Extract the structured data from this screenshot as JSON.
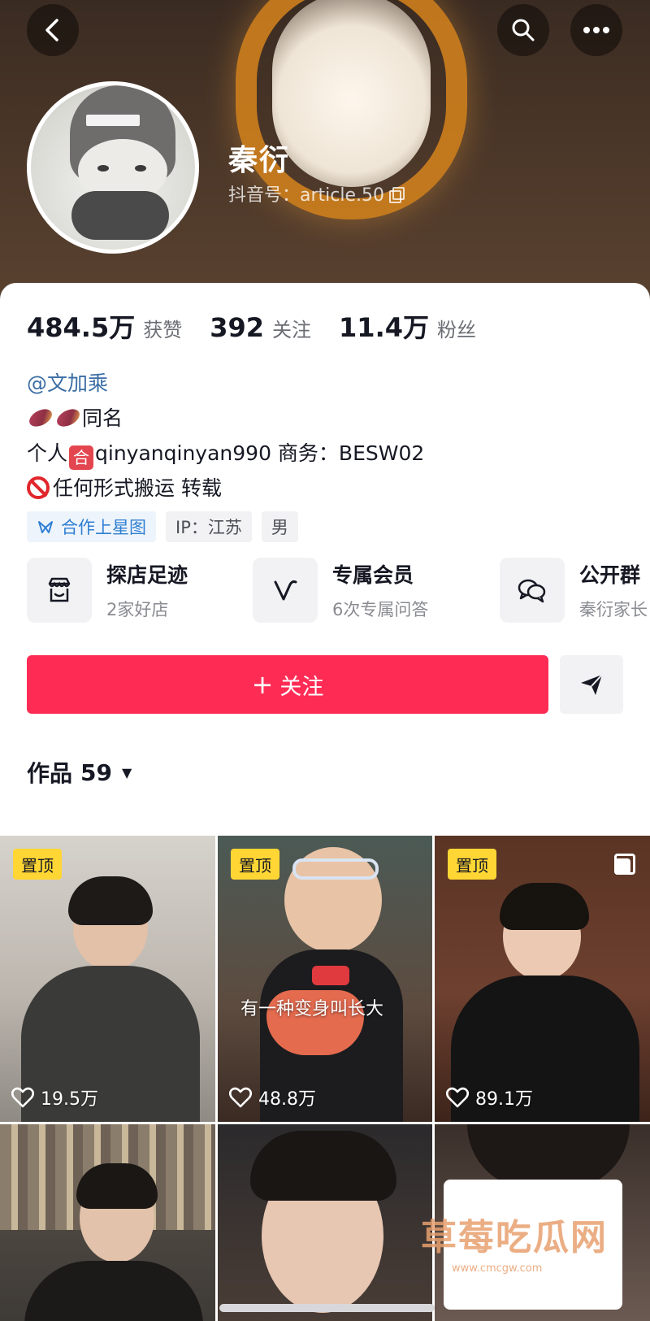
{
  "header": {
    "nickname": "秦衍",
    "douyin_id": "抖音号：article.50"
  },
  "stats": [
    {
      "value": "484.5万",
      "label": "获赞"
    },
    {
      "value": "392",
      "label": "关注"
    },
    {
      "value": "11.4万",
      "label": "粉丝"
    }
  ],
  "bio": {
    "mention": "@文加乘",
    "line2": "同名",
    "line3_prefix": "个人",
    "line3_badge": "合",
    "line3_rest": "qinyanqinyan990  商务：BESW02",
    "line4": "任何形式搬运 转载"
  },
  "tags": {
    "star": "合作上星图",
    "ip": "IP：江苏",
    "gender": "男"
  },
  "services": [
    {
      "title": "探店足迹",
      "sub": "2家好店"
    },
    {
      "title": "专属会员",
      "sub": "6次专属问答"
    },
    {
      "title": "公开群",
      "sub": "秦衍家长"
    }
  ],
  "follow": {
    "plus": "+",
    "label": "关注"
  },
  "works": {
    "label": "作品",
    "count": "59",
    "caret": "▼"
  },
  "videos": [
    {
      "pinned": "置顶",
      "likes": "19.5万"
    },
    {
      "pinned": "置顶",
      "likes": "48.8万",
      "caption": "有一种变身叫长大"
    },
    {
      "pinned": "置顶",
      "likes": "89.1万"
    }
  ],
  "watermark": {
    "text": "草莓吃瓜网",
    "url": "www.cmcgw.com"
  },
  "colors": {
    "accent": "#fe2c55",
    "pin": "#ffd634",
    "mention": "#3b6ea5"
  }
}
